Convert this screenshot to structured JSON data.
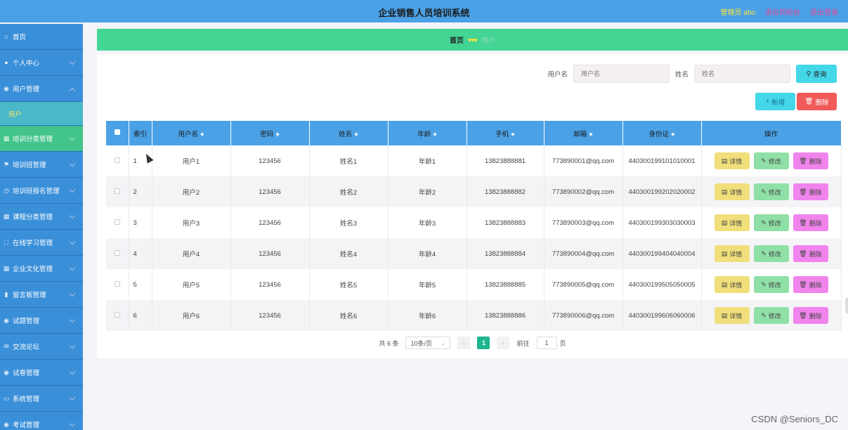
{
  "header": {
    "title": "企业销售人员培训系统",
    "admin_label": "管理员 abo",
    "back_label": "退出到前台",
    "logout_label": "退出登录"
  },
  "sidebar": {
    "items": [
      {
        "label": "首页",
        "icon": "home-icon"
      },
      {
        "label": "个人中心",
        "icon": "user-icon"
      },
      {
        "label": "用户管理",
        "icon": "location-icon"
      },
      {
        "label": "用户",
        "icon": ""
      },
      {
        "label": "培训分类管理",
        "icon": "grid-icon"
      },
      {
        "label": "培训班管理",
        "icon": "flag-icon"
      },
      {
        "label": "培训班报名管理",
        "icon": "clock-icon"
      },
      {
        "label": "课程分类管理",
        "icon": "grid-icon"
      },
      {
        "label": "在线学习管理",
        "icon": "expand-icon"
      },
      {
        "label": "企业文化管理",
        "icon": "grid-icon"
      },
      {
        "label": "留言板管理",
        "icon": "chart-icon"
      },
      {
        "label": "试题管理",
        "icon": "location-icon"
      },
      {
        "label": "交流论坛",
        "icon": "chat-icon"
      },
      {
        "label": "试卷管理",
        "icon": "location-icon"
      },
      {
        "label": "系统管理",
        "icon": "monitor-icon"
      },
      {
        "label": "考试管理",
        "icon": "location-icon"
      }
    ]
  },
  "breadcrumb": {
    "home": "首页",
    "hearts": "♥♥♥",
    "faint": "用户"
  },
  "search": {
    "username_label": "用户名",
    "username_placeholder": "用户名",
    "name_label": "姓名",
    "name_placeholder": "姓名",
    "query_label": "查询"
  },
  "actions": {
    "add_label": "新增",
    "delete_label": "删除"
  },
  "table": {
    "headers": [
      "索引",
      "用户名",
      "密码",
      "姓名",
      "年龄",
      "手机",
      "邮箱",
      "身份证",
      "操作"
    ],
    "rows": [
      {
        "index": "1",
        "username": "用户1",
        "password": "123456",
        "name": "姓名1",
        "age": "年龄1",
        "phone": "13823888881",
        "email": "773890001@qq.com",
        "id_card": "440300199101010001"
      },
      {
        "index": "2",
        "username": "用户2",
        "password": "123456",
        "name": "姓名2",
        "age": "年龄2",
        "phone": "13823888882",
        "email": "773890002@qq.com",
        "id_card": "440300199202020002"
      },
      {
        "index": "3",
        "username": "用户3",
        "password": "123456",
        "name": "姓名3",
        "age": "年龄3",
        "phone": "13823888883",
        "email": "773890003@qq.com",
        "id_card": "440300199303030003"
      },
      {
        "index": "4",
        "username": "用户4",
        "password": "123456",
        "name": "姓名4",
        "age": "年龄4",
        "phone": "13823888884",
        "email": "773890004@qq.com",
        "id_card": "440300199404040004"
      },
      {
        "index": "5",
        "username": "用户5",
        "password": "123456",
        "name": "姓名5",
        "age": "年龄5",
        "phone": "13823888885",
        "email": "773890005@qq.com",
        "id_card": "440300199505050005"
      },
      {
        "index": "6",
        "username": "用户6",
        "password": "123456",
        "name": "姓名6",
        "age": "年龄6",
        "phone": "13823888886",
        "email": "773890006@qq.com",
        "id_card": "440300199606060006"
      }
    ],
    "detail_label": "详情",
    "edit_label": "修改",
    "delete_label": "删除"
  },
  "pagination": {
    "total": "共 6 条",
    "page_size": "10条/页",
    "current_page": "1",
    "goto_label": "前往",
    "goto_value": "1",
    "page_unit": "页"
  },
  "watermark": "CSDN @Seniors_DC",
  "colors": {
    "header": "#4aa1e6",
    "sidebar": "#3a8fd9",
    "active_menu": "#43c48b",
    "breadcrumb_bar": "#43d594",
    "detail_button": "#f0df7a",
    "edit_button": "#8fe0a6",
    "delete_button": "#f184ec"
  }
}
